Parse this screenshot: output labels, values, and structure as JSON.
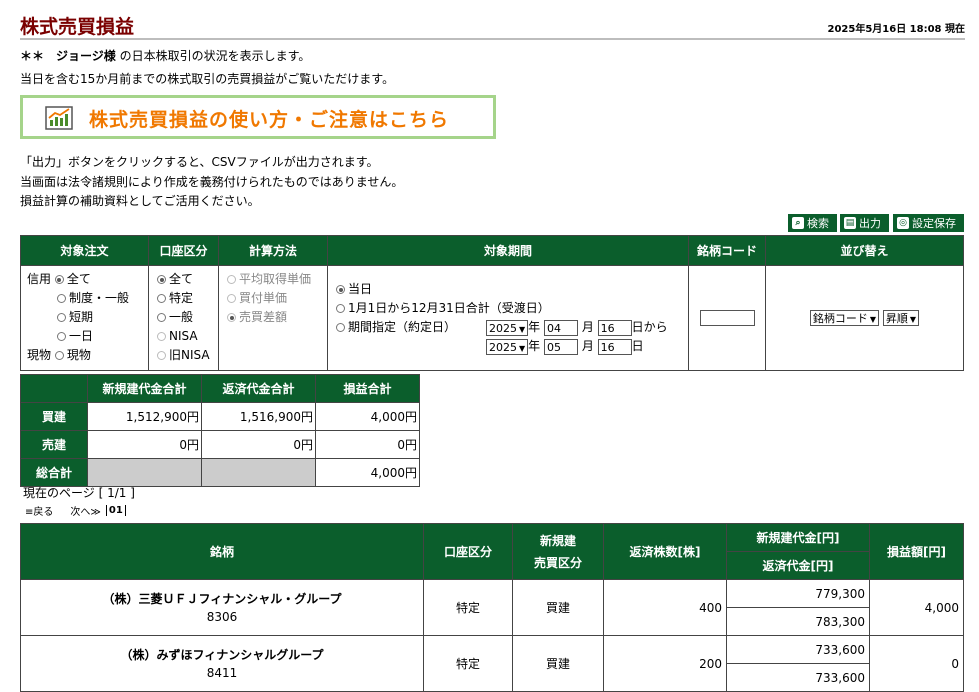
{
  "page": {
    "title": "株式売買損益",
    "as_of": "2025年5月16日 18:08 現在",
    "intro_name": "＊＊　ジョージ様",
    "intro_rest": " の日本株取引の状況を表示します。",
    "intro_line2": "当日を含む15か月前までの株式取引の売買損益がご覧いただけます。",
    "banner_text": "株式売買損益の使い方・ご注意はこちら",
    "note1": "「出力」ボタンをクリックすると、CSVファイルが出力されます。",
    "note2": "当画面は法令諸規則により作成を義務付けられたものではありません。",
    "note3": "損益計算の補助資料としてご活用ください。"
  },
  "toolbar": {
    "search": "検索",
    "output": "出力",
    "save": "設定保存"
  },
  "filters": {
    "headers": [
      "対象注文",
      "口座区分",
      "計算方法",
      "対象期間",
      "銘柄コード",
      "並び替え"
    ],
    "order": {
      "credit_label": "信用",
      "credit_options": [
        "全て",
        "制度・一般",
        "短期",
        "一日"
      ],
      "spot_label": "現物",
      "spot_option": "現物"
    },
    "account": [
      "全て",
      "特定",
      "一般",
      "NISA",
      "旧NISA"
    ],
    "calc": [
      "平均取得単価",
      "買付単価",
      "売買差額"
    ],
    "period": {
      "opt1": "当日",
      "opt2": "1月1日から12月31日合計（受渡日）",
      "opt3": "期間指定（約定日）",
      "from_year": "2025",
      "from_month": "04",
      "from_day": "16",
      "to_year": "2025",
      "to_month": "05",
      "to_day": "16",
      "year_unit": "年",
      "month_unit": "月",
      "day_unit": "日",
      "from_suffix": "日から",
      "to_suffix": "日"
    },
    "code_value": "",
    "sort": {
      "key": "銘柄コード",
      "order": "昇順"
    }
  },
  "summary": {
    "headers": [
      "",
      "新規建代金合計",
      "返済代金合計",
      "損益合計"
    ],
    "rows": [
      {
        "label": "買建",
        "new": "1,512,900円",
        "repay": "1,516,900円",
        "pl": "4,000円"
      },
      {
        "label": "売建",
        "new": "0円",
        "repay": "0円",
        "pl": "0円"
      },
      {
        "label": "総合計",
        "new": "",
        "repay": "",
        "pl": "4,000円"
      }
    ]
  },
  "pager": {
    "current": "現在のページ [ 1/1 ]",
    "prev": "戻る",
    "next": "次へ",
    "page1": "01"
  },
  "results": {
    "headers": {
      "name": "銘柄",
      "account": "口座区分",
      "side_l1": "新規建",
      "side_l2": "売買区分",
      "qty": "返済株数[株]",
      "new_amt": "新規建代金[円]",
      "repay_amt": "返済代金[円]",
      "pl": "損益額[円]"
    },
    "rows": [
      {
        "name": "（株）三菱ＵＦＪフィナンシャル・グループ",
        "code": "8306",
        "account": "特定",
        "side": "買建",
        "qty": "400",
        "new_amt": "779,300",
        "repay_amt": "783,300",
        "pl": "4,000"
      },
      {
        "name": "（株）みずほフィナンシャルグループ",
        "code": "8411",
        "account": "特定",
        "side": "買建",
        "qty": "200",
        "new_amt": "733,600",
        "repay_amt": "733,600",
        "pl": "0"
      }
    ]
  },
  "colors": {
    "header_green": "#0b5e2c",
    "title_red": "#7a0000",
    "banner_orange": "#f07800",
    "banner_border": "#a5d48a"
  }
}
